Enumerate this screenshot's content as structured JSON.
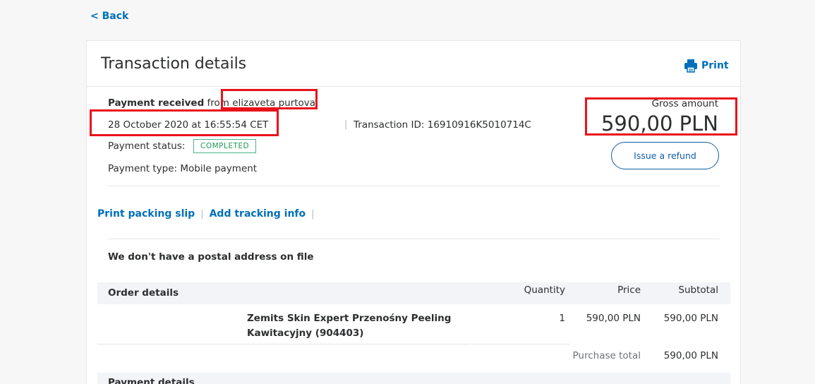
{
  "nav": {
    "back_label": "< Back"
  },
  "header": {
    "title": "Transaction details",
    "print_label": "Print"
  },
  "payment": {
    "received_label": "Payment received",
    "from_word": "from",
    "sender_name": "elizaveta purtova",
    "datetime": "28 October 2020 at 16:55:54 CET",
    "transaction_id_label": "Transaction ID: 16910916K5010714C",
    "status_label": "Payment status:",
    "status_value": "COMPLETED",
    "type_label": "Payment type: Mobile payment",
    "separator": "|"
  },
  "amount": {
    "gross_label": "Gross amount",
    "gross_value": "590,00 PLN",
    "refund_button": "Issue a refund"
  },
  "actions": {
    "print_packing_slip": "Print packing slip",
    "add_tracking_info": "Add tracking info",
    "separator": "|"
  },
  "shipping": {
    "no_address": "We don't have a postal address on file"
  },
  "order": {
    "header": {
      "details": "Order details",
      "quantity": "Quantity",
      "price": "Price",
      "subtotal": "Subtotal"
    },
    "items": [
      {
        "name_line1": "Zemits Skin Expert Przenośny Peeling",
        "name_line2": "Kawitacyjny (904403)",
        "quantity": "1",
        "price": "590,00 PLN",
        "subtotal": "590,00 PLN"
      }
    ],
    "purchase_total_label": "Purchase total",
    "purchase_total_value": "590,00 PLN"
  },
  "payment_details": {
    "header": "Payment details"
  },
  "colors": {
    "link": "#0070ba",
    "highlight": "#e8121b",
    "badge": "#1e9955"
  },
  "icons": {
    "print": "printer-icon"
  }
}
